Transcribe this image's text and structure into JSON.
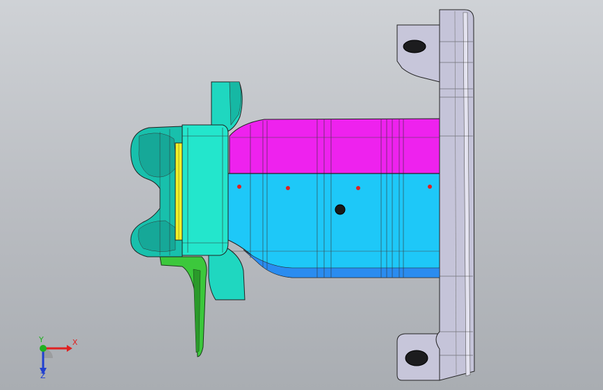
{
  "triad": {
    "x_label": "X",
    "y_label": "Y",
    "z_label": "Z",
    "x_color": "#e02020",
    "y_color": "#20b020",
    "z_color": "#2040d0"
  },
  "colors": {
    "background_top": "#cfd2d6",
    "background_bottom": "#a9adb2",
    "bracket": "#c9c8dc",
    "upper_tube": "#ee22ee",
    "lower_tube": "#1ec8f8",
    "flange": "#1ee4c8",
    "end_cap": "#18b8a8",
    "shim": "#f2f22a",
    "clip": "#3cc83c",
    "marker": "#e02020"
  }
}
